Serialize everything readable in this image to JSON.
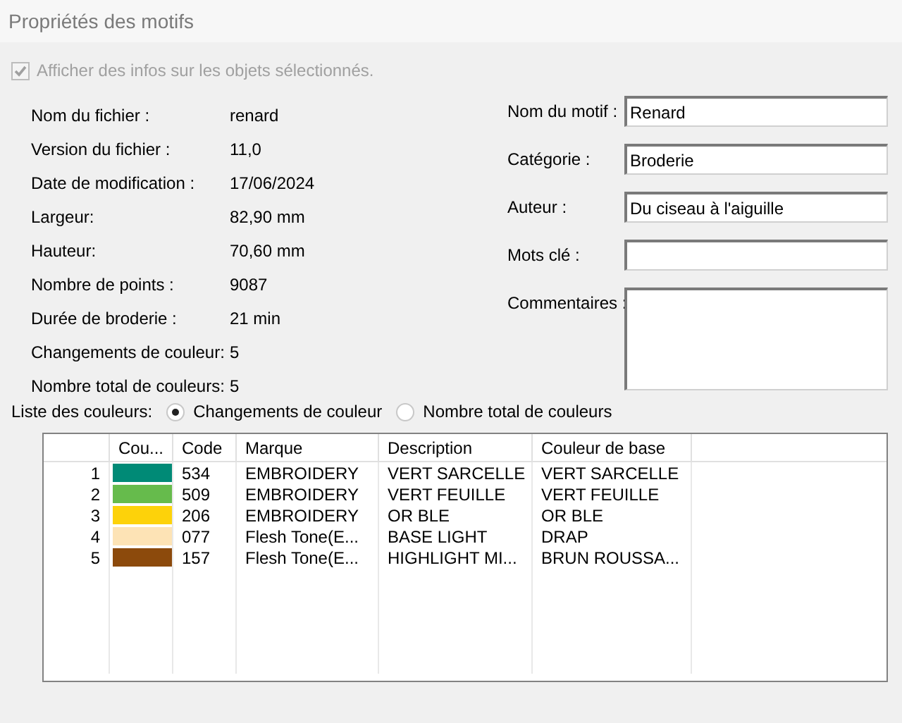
{
  "window": {
    "title": "Propriétés des motifs"
  },
  "show_info": {
    "label": "Afficher des infos sur les objets sélectionnés.",
    "checked": true,
    "disabled": true
  },
  "info": [
    {
      "label": "Nom du fichier :",
      "value": "renard"
    },
    {
      "label": "Version du fichier :",
      "value": "11,0"
    },
    {
      "label": "Date de modification :",
      "value": "17/06/2024"
    },
    {
      "label": "Largeur:",
      "value": "82,90 mm"
    },
    {
      "label": "Hauteur:",
      "value": "70,60 mm"
    },
    {
      "label": "Nombre de points :",
      "value": "9087"
    },
    {
      "label": "Durée de broderie :",
      "value": "21 min"
    },
    {
      "label": "Changements de couleur:",
      "value": "5"
    },
    {
      "label": "Nombre total de couleurs:",
      "value": "5"
    }
  ],
  "fields": [
    {
      "kind": "line",
      "label": "Nom du motif :",
      "value": "Renard"
    },
    {
      "kind": "line",
      "label": "Catégorie :",
      "value": "Broderie"
    },
    {
      "kind": "line",
      "label": "Auteur :",
      "value": "Du ciseau à l'aiguille"
    },
    {
      "kind": "line",
      "label": "Mots clé :"
    },
    {
      "kind": "multiline",
      "label": "Commentaires :"
    }
  ],
  "color_list": {
    "label": "Liste des couleurs:",
    "options": [
      {
        "label": "Changements de couleur",
        "selected": true
      },
      {
        "label": "Nombre total de couleurs",
        "selected": false
      }
    ]
  },
  "table": {
    "columns": [
      "Cou...",
      "Code",
      "Marque",
      "Description",
      "Couleur de base"
    ],
    "rows": [
      {
        "number": "1",
        "color": "#008a76",
        "code": "534",
        "brand": "EMBROIDERY",
        "description": "VERT SARCELLE",
        "base": "VERT SARCELLE"
      },
      {
        "number": "2",
        "color": "#66bb4c",
        "code": "509",
        "brand": "EMBROIDERY",
        "description": "VERT FEUILLE",
        "base": "VERT FEUILLE"
      },
      {
        "number": "3",
        "color": "#fdd20a",
        "code": "206",
        "brand": "EMBROIDERY",
        "description": "OR BLE",
        "base": "OR BLE"
      },
      {
        "number": "4",
        "color": "#fde3b5",
        "code": "077",
        "brand": "Flesh Tone(E...",
        "description": "BASE LIGHT",
        "base": "DRAP"
      },
      {
        "number": "5",
        "color": "#8c4a0c",
        "code": "157",
        "brand": "Flesh Tone(E...",
        "description": "HIGHLIGHT MI...",
        "base": "BRUN ROUSSA..."
      }
    ]
  }
}
